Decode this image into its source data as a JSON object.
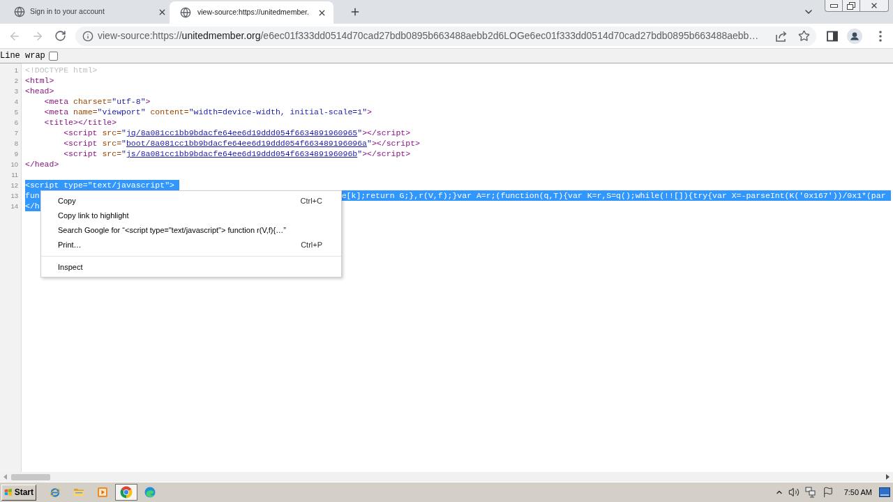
{
  "browser": {
    "tabs": [
      {
        "title": "Sign in to your account",
        "selected": false
      },
      {
        "title": "view-source:https://unitedmember.",
        "selected": true
      }
    ],
    "navigation": {
      "back_disabled": true,
      "forward_disabled": true
    },
    "address": {
      "scheme": "view-source:https://",
      "host": "unitedmember.org",
      "path": "/e6ec01f333dd0514d70cad27bdb0895b663488aebb2d6LOGe6ec01f333dd0514d70cad27bdb0895b663488aebb…"
    }
  },
  "line_wrap": {
    "label": "Line wrap",
    "checked": false
  },
  "source_lines": [
    {
      "number": "1",
      "selected": false,
      "tokens": [
        {
          "kind": "doctype",
          "text": "<!DOCTYPE html>"
        }
      ]
    },
    {
      "number": "2",
      "selected": false,
      "tokens": [
        {
          "kind": "tag",
          "text": "<html>"
        }
      ]
    },
    {
      "number": "3",
      "selected": false,
      "tokens": [
        {
          "kind": "tag",
          "text": "<head>"
        }
      ]
    },
    {
      "number": "4",
      "selected": false,
      "tokens": [
        {
          "kind": "tag",
          "text": "    <meta"
        },
        {
          "kind": "attr",
          "text": " charset="
        },
        {
          "kind": "value",
          "text": "\"utf-8\""
        },
        {
          "kind": "tag",
          "text": ">"
        }
      ]
    },
    {
      "number": "5",
      "selected": false,
      "tokens": [
        {
          "kind": "tag",
          "text": "    <meta"
        },
        {
          "kind": "attr",
          "text": " name="
        },
        {
          "kind": "value",
          "text": "\"viewport\""
        },
        {
          "kind": "attr",
          "text": " content="
        },
        {
          "kind": "value",
          "text": "\"width=device-width, initial-scale=1\""
        },
        {
          "kind": "tag",
          "text": ">"
        }
      ]
    },
    {
      "number": "6",
      "selected": false,
      "tokens": [
        {
          "kind": "tag",
          "text": "    <title></title>"
        }
      ]
    },
    {
      "number": "7",
      "selected": false,
      "tokens": [
        {
          "kind": "tag",
          "text": "        <script"
        },
        {
          "kind": "attr",
          "text": " src="
        },
        {
          "kind": "value",
          "text": "\""
        },
        {
          "kind": "link",
          "text": "jq/8a081cc1bb9bdacfe64ee6d19ddd054f6634891960965"
        },
        {
          "kind": "value",
          "text": "\""
        },
        {
          "kind": "tag",
          "text": "></script>"
        }
      ]
    },
    {
      "number": "8",
      "selected": false,
      "tokens": [
        {
          "kind": "tag",
          "text": "        <script"
        },
        {
          "kind": "attr",
          "text": " src="
        },
        {
          "kind": "value",
          "text": "\""
        },
        {
          "kind": "link",
          "text": "boot/8a081cc1bb9bdacfe64ee6d19ddd054f663489196096a"
        },
        {
          "kind": "value",
          "text": "\""
        },
        {
          "kind": "tag",
          "text": "></script>"
        }
      ]
    },
    {
      "number": "9",
      "selected": false,
      "tokens": [
        {
          "kind": "tag",
          "text": "        <script"
        },
        {
          "kind": "attr",
          "text": " src="
        },
        {
          "kind": "value",
          "text": "\""
        },
        {
          "kind": "link",
          "text": "js/8a081cc1bb9bdacfe64ee6d19ddd054f663489196096b"
        },
        {
          "kind": "value",
          "text": "\""
        },
        {
          "kind": "tag",
          "text": "></script>"
        }
      ]
    },
    {
      "number": "10",
      "selected": false,
      "tokens": [
        {
          "kind": "tag",
          "text": "</head>"
        }
      ]
    },
    {
      "number": "11",
      "selected": false
    },
    {
      "number": "12",
      "selected": true,
      "fragments": [
        "<script type=\"text/javascript\">"
      ]
    },
    {
      "number": "13",
      "selected": true,
      "fragments": [
        "fun",
        "e[k];return G;},r(V,f);}var A=r;(function(q,T){var K=r,S=q();while(!![]){try{var X=-parseInt(K('0x167'))/0x1*(par"
      ]
    },
    {
      "number": "14",
      "selected": true,
      "fragments": [
        "</h"
      ]
    }
  ],
  "context_menu": {
    "items": [
      {
        "kind": "item",
        "label": "Copy",
        "shortcut": "Ctrl+C"
      },
      {
        "kind": "item",
        "label": "Copy link to highlight"
      },
      {
        "kind": "item",
        "label": "Search Google for “<script type=\"text/javascript\"> function r(V,f){…”"
      },
      {
        "kind": "item",
        "label": "Print…",
        "shortcut": "Ctrl+P"
      },
      {
        "kind": "separator"
      },
      {
        "kind": "item",
        "label": "Inspect"
      }
    ]
  },
  "taskbar": {
    "start_label": "Start",
    "apps": [
      {
        "selected": false
      },
      {
        "selected": false
      },
      {
        "selected": false
      },
      {
        "selected": true
      },
      {
        "selected": false
      }
    ],
    "clock": "7:50 AM"
  }
}
